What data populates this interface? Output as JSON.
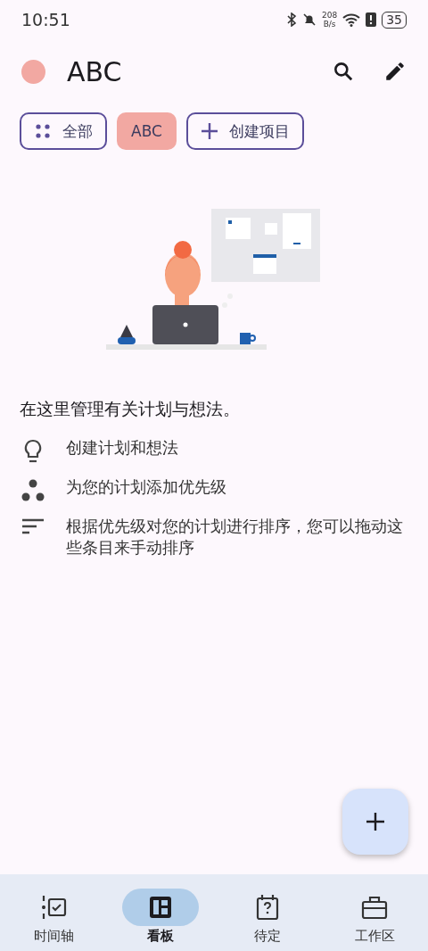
{
  "status_bar": {
    "time": "10:51",
    "net_speed": "208",
    "net_unit": "B/s",
    "battery": "35"
  },
  "header": {
    "title": "ABC",
    "color": "#f2a8a2"
  },
  "chips": [
    {
      "kind": "all",
      "label": "全部",
      "selected": false
    },
    {
      "kind": "project",
      "label": "ABC",
      "selected": true,
      "color": "#f2a8a2"
    },
    {
      "kind": "create",
      "label": "创建项目",
      "selected": false
    }
  ],
  "empty_state": {
    "heading": "在这里管理有关计划与想法。",
    "tips": [
      {
        "kind": "bulb",
        "text": "创建计划和想法"
      },
      {
        "kind": "dots",
        "text": "为您的计划添加优先级"
      },
      {
        "kind": "sort",
        "text": "根据优先级对您的计划进行排序，您可以拖动这些条目来手动排序"
      }
    ]
  },
  "nav": [
    {
      "kind": "timeline",
      "label": "时间轴",
      "selected": false
    },
    {
      "kind": "board",
      "label": "看板",
      "selected": true
    },
    {
      "kind": "pending",
      "label": "待定",
      "selected": false
    },
    {
      "kind": "workspace",
      "label": "工作区",
      "selected": false
    }
  ]
}
